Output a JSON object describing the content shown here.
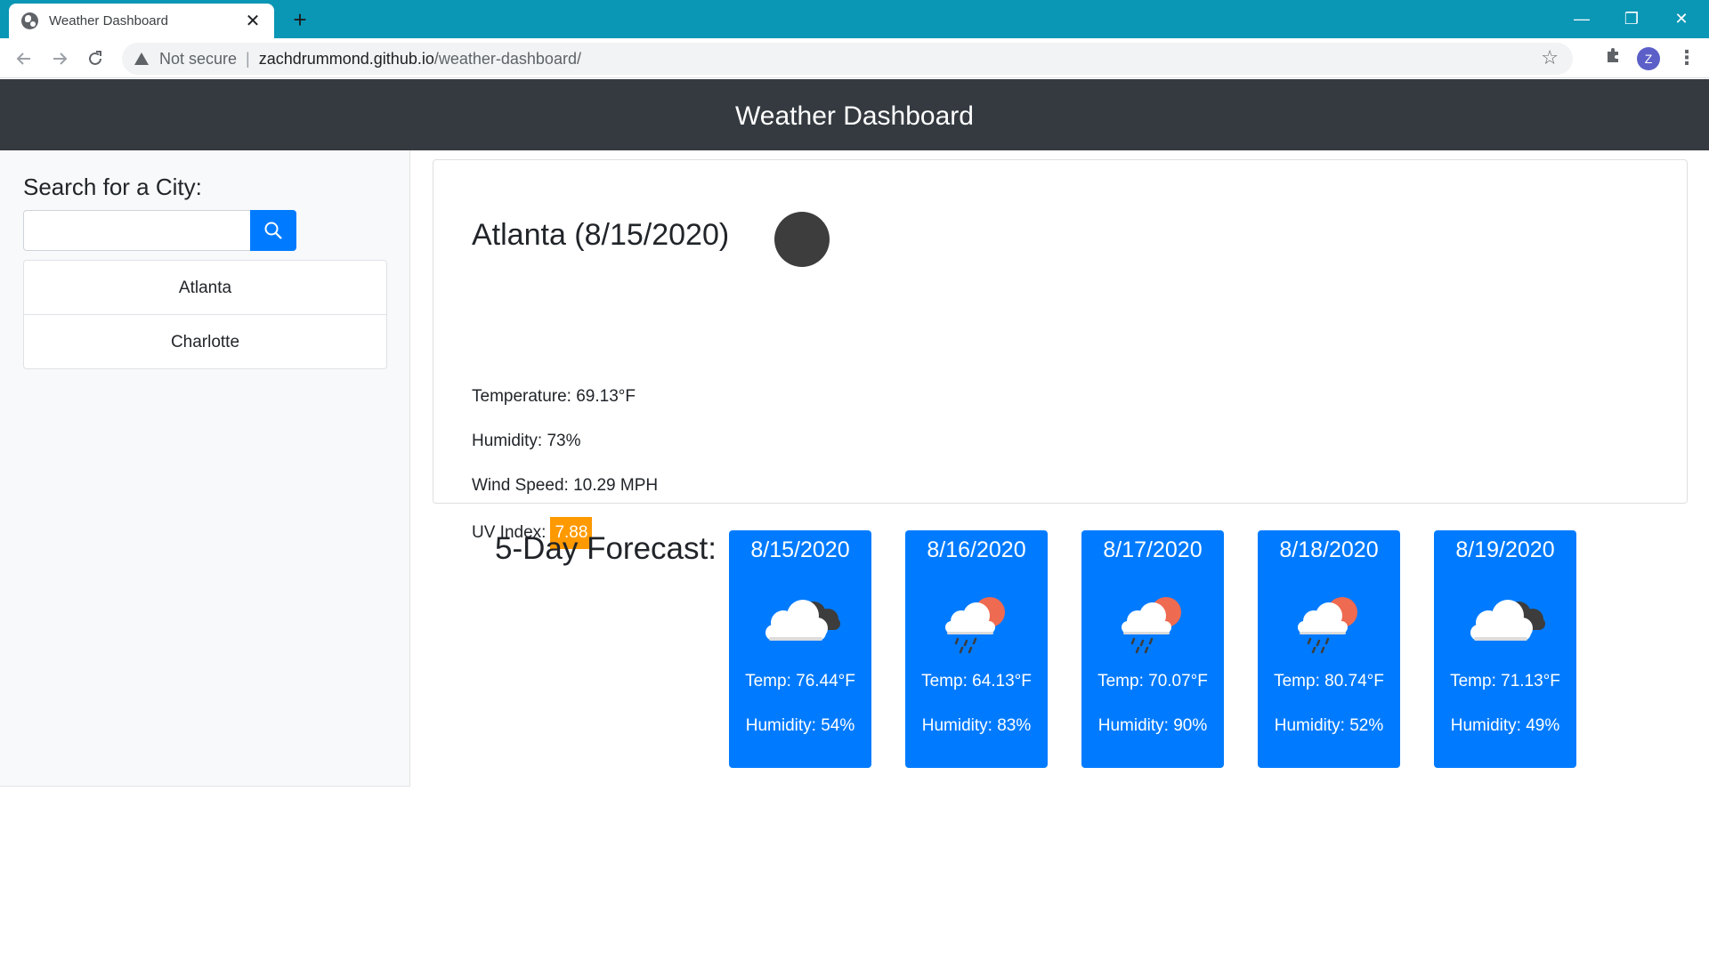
{
  "browser": {
    "tab_title": "Weather Dashboard",
    "tab_close": "✕",
    "new_tab": "+",
    "security_label": "Not secure",
    "url_host": "zachdrummond.github.io",
    "url_path": "/weather-dashboard/",
    "profile_initial": "Z",
    "window_controls": {
      "minimize": "—",
      "maximize": "❐",
      "close": "✕"
    },
    "icons": [
      "globe-icon",
      "back-arrow-icon",
      "forward-arrow-icon",
      "reload-icon",
      "warning-icon",
      "star-icon",
      "puzzle-icon",
      "more-vert-icon"
    ]
  },
  "header": {
    "title": "Weather Dashboard"
  },
  "sidebar": {
    "search_label": "Search for a City:",
    "search_value": "",
    "search_icon": "search-icon",
    "cities": [
      {
        "label": "Atlanta"
      },
      {
        "label": "Charlotte"
      }
    ]
  },
  "current": {
    "heading": "Atlanta (8/15/2020)",
    "temperature": "Temperature: 69.13°F",
    "humidity": "Humidity: 73%",
    "wind": "Wind Speed: 10.29 MPH",
    "uv_label": "UV Index:",
    "uv_value": "7.88",
    "uv_color": "#ff9900"
  },
  "forecast": {
    "label": "5-Day Forecast:",
    "days": [
      {
        "date": "8/15/2020",
        "icon": "cloud-icon",
        "temp": "Temp: 76.44°F",
        "humidity": "Humidity: 54%"
      },
      {
        "date": "8/16/2020",
        "icon": "rain-sun-icon",
        "temp": "Temp: 64.13°F",
        "humidity": "Humidity: 83%"
      },
      {
        "date": "8/17/2020",
        "icon": "rain-sun-icon",
        "temp": "Temp: 70.07°F",
        "humidity": "Humidity: 90%"
      },
      {
        "date": "8/18/2020",
        "icon": "rain-sun-icon",
        "temp": "Temp: 80.74°F",
        "humidity": "Humidity: 52%"
      },
      {
        "date": "8/19/2020",
        "icon": "cloud-icon",
        "temp": "Temp: 71.13°F",
        "humidity": "Humidity: 49%"
      }
    ]
  },
  "colors": {
    "header_bg": "#343a40",
    "card_blue": "#007bff",
    "titlebar": "#0a96b5"
  }
}
